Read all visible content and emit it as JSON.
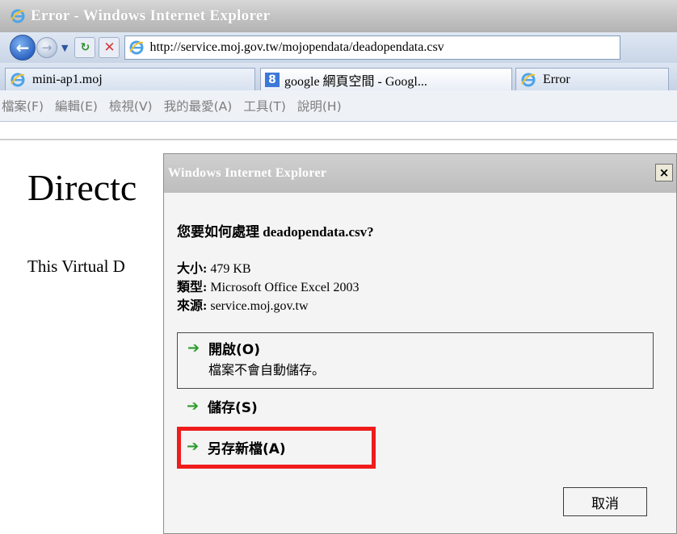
{
  "window": {
    "title": "Error - Windows Internet Explorer"
  },
  "toolbar": {
    "back_icon": "back-arrow-icon",
    "forward_icon": "forward-arrow-icon",
    "address": "http://service.moj.gov.tw/mojopendata/deadopendata.csv"
  },
  "tabs": [
    {
      "label": "mini-ap1.moj",
      "icon": "ie-icon"
    },
    {
      "label": "google 網頁空間 - Googl...",
      "icon": "google-icon",
      "icon_text": "8"
    },
    {
      "label": "Error",
      "icon": "ie-icon"
    }
  ],
  "menu": [
    "檔案(F)",
    "編輯(E)",
    "檢視(V)",
    "我的最愛(A)",
    "工具(T)",
    "說明(H)"
  ],
  "page": {
    "heading": "Directc",
    "text": "This Virtual D"
  },
  "dialog": {
    "title": "Windows Internet Explorer",
    "close_label": "×",
    "question": "您要如何處理 deadopendata.csv?",
    "info": [
      {
        "key": "大小:",
        "value": " 479 KB"
      },
      {
        "key": "類型:",
        "value": " Microsoft Office Excel 2003"
      },
      {
        "key": "來源:",
        "value": " service.moj.gov.tw"
      }
    ],
    "options": {
      "open": {
        "label": "開啟(O)",
        "sub": "檔案不會自動儲存。"
      },
      "save": {
        "label": "儲存(S)"
      },
      "save_as": {
        "label": "另存新檔(A)"
      }
    },
    "cancel_label": "取消"
  },
  "colors": {
    "highlight": "#ef1c1c",
    "arrow": "#2a9d2a"
  }
}
